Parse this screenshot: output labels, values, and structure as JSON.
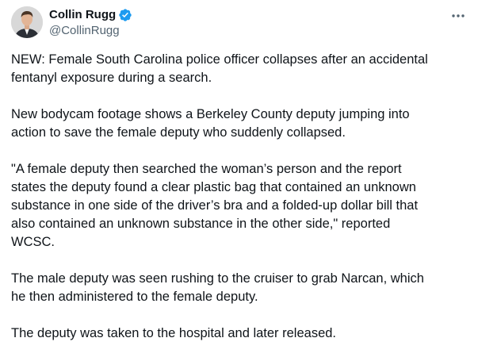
{
  "author": {
    "display_name": "Collin Rugg",
    "handle": "@CollinRugg",
    "verified": true,
    "verified_color": "#1d9bf0"
  },
  "tweet": {
    "paragraphs": [
      "NEW: Female South Carolina police officer collapses after an accidental\nfentanyl exposure during a search.",
      "New bodycam footage shows a Berkeley County deputy jumping into\naction to save the female deputy who suddenly collapsed.",
      "\"A female deputy then searched the woman’s person and the report\nstates the deputy found a clear plastic bag that contained an unknown\nsubstance in one side of the driver’s bra and a folded-up dollar bill that\nalso contained an unknown substance in the other side,\" reported\nWCSC.",
      "The male deputy was seen rushing to the cruiser to grab Narcan, which\nhe then administered to the female deputy.",
      "The deputy was taken to the hospital and later released."
    ]
  },
  "icons": {
    "avatar": "avatar-photo",
    "verified": "verified-badge-icon",
    "more": "more-options-icon"
  }
}
